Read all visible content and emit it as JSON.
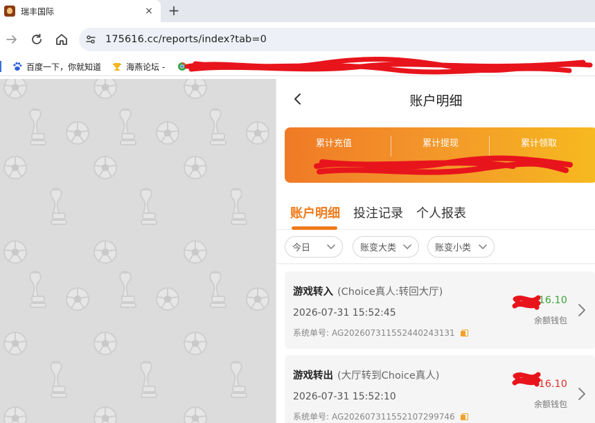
{
  "browser": {
    "tab_title": "瑞丰国际",
    "close_glyph": "×",
    "newtab_glyph": "+",
    "url": "175616.cc/reports/index?tab=0",
    "bookmarks": [
      "百度一下，你就知道",
      "海燕论坛 -"
    ]
  },
  "page": {
    "title": "账户明细",
    "summary": {
      "labels": [
        "累计充值",
        "累计提现",
        "累计领取"
      ],
      "values": [
        "",
        "",
        ""
      ]
    },
    "tabs": [
      "账户明细",
      "投注记录",
      "个人报表"
    ],
    "active_tab": 0,
    "filters": [
      "今日",
      "账变大类",
      "账变小类"
    ],
    "order_label": "系统单号:",
    "records": [
      {
        "type": "游戏转入",
        "detail": "(Choice真人:转回大厅)",
        "time": "2026-07-31 15:52:45",
        "order_no": "AG202607311552440243131",
        "amount": "16.10",
        "amount_color": "#3aa53a",
        "wallet": "余额钱包"
      },
      {
        "type": "游戏转出",
        "detail": "(大厅转到Choice真人)",
        "time": "2026-07-31 15:52:10",
        "order_no": "AG202607311552107299746",
        "amount": "16.10",
        "amount_color": "#e0312d",
        "wallet": "余额钱包"
      }
    ]
  },
  "colors": {
    "accent": "#f07a1a",
    "redaction": "#e8141c",
    "summary_gradient_start": "#f07a26",
    "summary_gradient_end": "#f6ba1f"
  }
}
